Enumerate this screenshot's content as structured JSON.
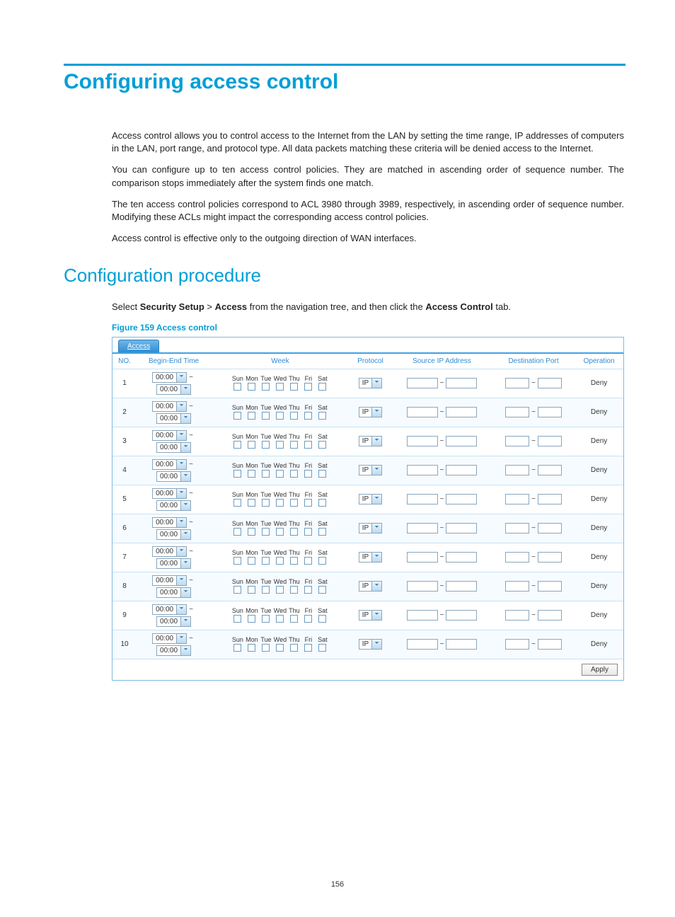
{
  "title": "Configuring access control",
  "paragraphs": {
    "p1": "Access control allows you to control access to the Internet from the LAN by setting the time range, IP addresses of computers in the LAN, port range, and protocol type. All data packets matching these criteria will be denied access to the Internet.",
    "p2": "You can configure up to ten access control policies. They are matched in ascending order of sequence number. The comparison stops immediately after the system finds one match.",
    "p3": "The ten access control policies correspond to ACL 3980 through 3989, respectively, in ascending order of sequence number. Modifying these ACLs might impact the corresponding access control policies.",
    "p4": "Access control is effective only to the outgoing direction of WAN interfaces."
  },
  "subtitle": "Configuration procedure",
  "nav": {
    "prefix": "Select ",
    "step1": "Security Setup",
    "gt": " > ",
    "step2": "Access",
    "mid": " from the navigation tree, and then click the ",
    "tab": "Access Control",
    "suffix": " tab."
  },
  "figure_caption": "Figure 159 Access control",
  "screenshot": {
    "tab_label": "Access",
    "headers": {
      "no": "NO.",
      "time": "Begin-End Time",
      "week": "Week",
      "protocol": "Protocol",
      "srcip": "Source IP Address",
      "dstport": "Destination Port",
      "operation": "Operation"
    },
    "days": [
      "Sun",
      "Mon",
      "Tue",
      "Wed",
      "Thu",
      "Fri",
      "Sat"
    ],
    "time_default": "00:00",
    "proto_default": "IP",
    "row_sep": "~",
    "operation_label": "Deny",
    "apply_label": "Apply",
    "rows": [
      {
        "no": "1"
      },
      {
        "no": "2"
      },
      {
        "no": "3"
      },
      {
        "no": "4"
      },
      {
        "no": "5"
      },
      {
        "no": "6"
      },
      {
        "no": "7"
      },
      {
        "no": "8"
      },
      {
        "no": "9"
      },
      {
        "no": "10"
      }
    ]
  },
  "page_number": "156"
}
